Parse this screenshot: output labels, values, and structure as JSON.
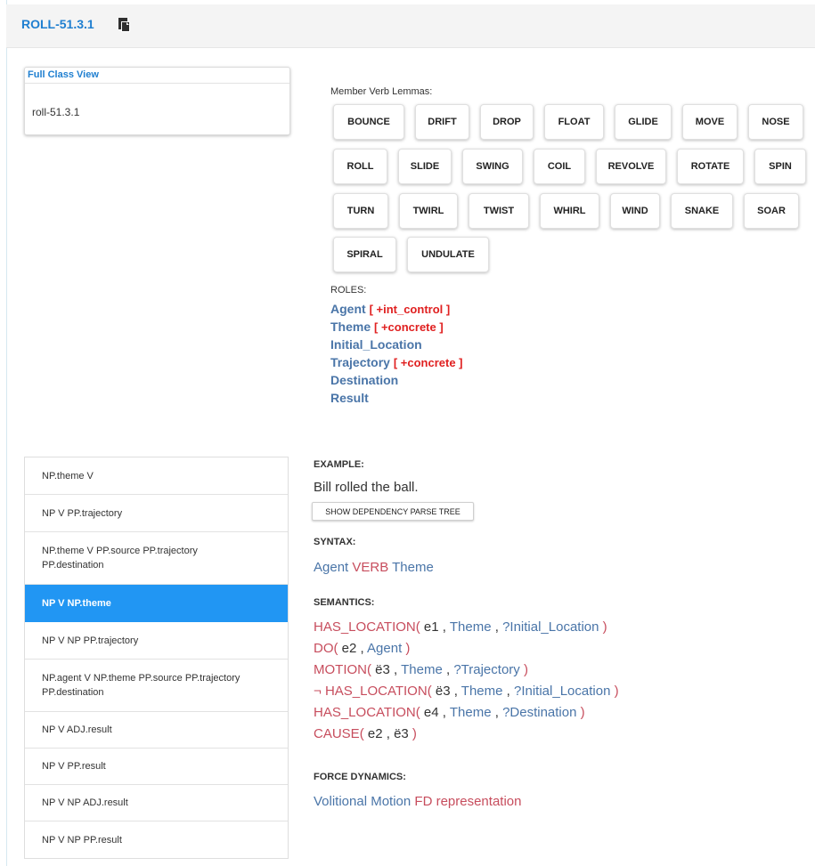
{
  "header": {
    "title": "ROLL-51.3.1",
    "icon": "paste-icon"
  },
  "full_class_view": {
    "title": "Full Class View",
    "class_name": "roll-51.3.1"
  },
  "member_verbs": {
    "label": "Member Verb Lemmas:",
    "items": [
      "BOUNCE",
      "DRIFT",
      "DROP",
      "FLOAT",
      "GLIDE",
      "MOVE",
      "NOSE",
      "ROLL",
      "SLIDE",
      "SWING",
      "COIL",
      "REVOLVE",
      "ROTATE",
      "SPIN",
      "TURN",
      "TWIRL",
      "TWIST",
      "WHIRL",
      "WIND",
      "SNAKE",
      "SOAR",
      "SPIRAL",
      "UNDULATE"
    ]
  },
  "roles": {
    "label": "ROLES:",
    "items": [
      {
        "name": "Agent",
        "restriction": "[ +int_control ]"
      },
      {
        "name": "Theme",
        "restriction": "[ +concrete ]"
      },
      {
        "name": "Initial_Location",
        "restriction": ""
      },
      {
        "name": "Trajectory",
        "restriction": "[ +concrete ]"
      },
      {
        "name": "Destination",
        "restriction": ""
      },
      {
        "name": "Result",
        "restriction": ""
      }
    ]
  },
  "frames": [
    "NP.theme V",
    "NP V PP.trajectory",
    "NP.theme V PP.source PP.trajectory PP.destination",
    "NP V NP.theme",
    "NP V NP PP.trajectory",
    "NP.agent V NP.theme PP.source PP.trajectory PP.destination",
    "NP V ADJ.result",
    "NP V PP.result",
    "NP V NP ADJ.result",
    "NP V NP PP.result"
  ],
  "selected_frame": "NP V NP.theme",
  "detail": {
    "example_label": "EXAMPLE:",
    "example": "Bill rolled the ball.",
    "parse_button": "SHOW DEPENDENCY PARSE TREE",
    "syntax_label": "SYNTAX:",
    "syntax": [
      "Agent",
      "VERB",
      "Theme"
    ],
    "semantics_label": "SEMANTICS:",
    "semantics": [
      {
        "neg": "",
        "pred": "HAS_LOCATION",
        "event": "e1",
        "args": [
          "Theme",
          "?Initial_Location"
        ]
      },
      {
        "neg": "",
        "pred": "DO",
        "event": "e2",
        "args": [
          "Agent"
        ]
      },
      {
        "neg": "",
        "pred": "MOTION",
        "event": "ë3",
        "args": [
          "Theme",
          "?Trajectory"
        ]
      },
      {
        "neg": "¬",
        "pred": "HAS_LOCATION",
        "event": "ë3",
        "args": [
          "Theme",
          "?Initial_Location"
        ]
      },
      {
        "neg": "",
        "pred": "HAS_LOCATION",
        "event": "e4",
        "args": [
          "Theme",
          "?Destination"
        ]
      },
      {
        "neg": "",
        "pred": "CAUSE",
        "event": "e2",
        "args": [
          "ë3"
        ]
      }
    ],
    "force_label": "FORCE DYNAMICS:",
    "force_role": "Volitional Motion",
    "force_pred": "FD representation"
  },
  "colors": {
    "link": "#1f7fd0",
    "role": "#4a75a8",
    "predicate": "#c74d5d",
    "restriction": "#e02020",
    "active": "#2196f3"
  }
}
